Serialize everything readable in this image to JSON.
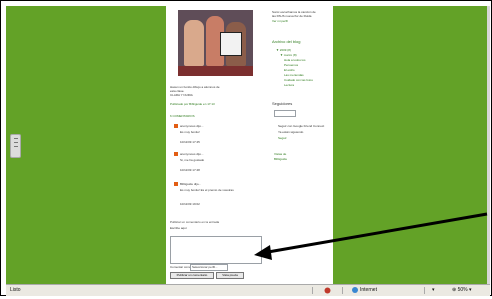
{
  "blog": {
    "header_lines": [
      "Sonic escuchamos la canción de",
      "las PAUS nueva flor de Ruida",
      "Ver mi perfil"
    ],
    "post": {
      "caption_lines": [
        "Hacen un bonito dibujo a alumnos de",
        "esta clase.",
        "CLARA Y NURIA"
      ],
      "published_by": "Publicado por Bibliguide en 17:13",
      "comments_title": "6 COMENTARIOS"
    },
    "comments": [
      {
        "author": "anonymous dijo...",
        "text": "Es muy bonito!",
        "date": "10/11/09 17:45"
      },
      {
        "author": "anonymous dijo...",
        "text": "Si, me ha gustado",
        "date": "10/11/09 17:48"
      },
      {
        "author": "Bibliguide dijo...",
        "text": "Es muy bonito! Es el premio de vosotras",
        "date": "10/11/09 19:02"
      }
    ],
    "comment_form": {
      "title": "Publicar un comentario en la entrada",
      "prompt": "Escribe aquí",
      "identity_label": "Comentar como:",
      "identity_value": "Seleccionar perfil...",
      "publish_label": "Publicar un comentario",
      "preview_label": "Vista previa"
    },
    "sidebar": {
      "archive_title": "Archivo del blog",
      "archive_items": [
        "▼ 2009 (8)",
        "▼ marzo (8)",
        "Hola a todos los",
        "Pensemos",
        "El estilo",
        "Las meriendas",
        "Cuidado con las fotos",
        "Lectura"
      ],
      "labels_title": "Seguidores",
      "follow_text": "Seguir con Google Friend Connect",
      "members_text": "Ya están siguiendo",
      "follow_link": "Seguir",
      "links": [
        "Vistas de",
        "Bibliguide"
      ]
    }
  },
  "statusbar": {
    "status": "Listo",
    "zone": "Internet",
    "zoom": "50%"
  },
  "colors": {
    "background": "#63a227",
    "link_green": "#2d7a1c"
  }
}
